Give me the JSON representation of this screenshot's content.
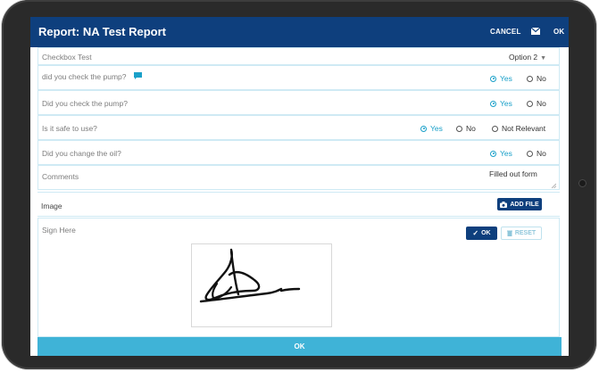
{
  "header": {
    "title": "Report: NA Test Report",
    "cancel_label": "CANCEL",
    "ok_label": "OK",
    "mail_icon": "mail-icon"
  },
  "fields": {
    "checkbox_test": {
      "label": "Checkbox Test",
      "value": "Option 2"
    },
    "pump1": {
      "label": "did you check the pump?",
      "options": [
        "Yes",
        "No"
      ],
      "selected": "Yes"
    },
    "pump2": {
      "label": "Did you check the pump?",
      "options": [
        "Yes",
        "No"
      ],
      "selected": "Yes"
    },
    "safe": {
      "label": "Is it safe to use?",
      "options": [
        "Yes",
        "No",
        "Not Relevant"
      ],
      "selected": "Yes"
    },
    "oil": {
      "label": "Did you change the oil?",
      "options": [
        "Yes",
        "No"
      ],
      "selected": "Yes"
    },
    "comments": {
      "label": "Comments",
      "value": "Filled out form"
    },
    "image": {
      "label": "Image",
      "add_file_label": "ADD FILE"
    },
    "sign": {
      "label": "Sign Here",
      "ok_label": "OK",
      "reset_label": "RESET"
    }
  },
  "footer": {
    "ok_label": "OK"
  },
  "colors": {
    "header": "#0e3f7d",
    "accent": "#1aa0c9",
    "ok_bar": "#3fb3d7"
  }
}
